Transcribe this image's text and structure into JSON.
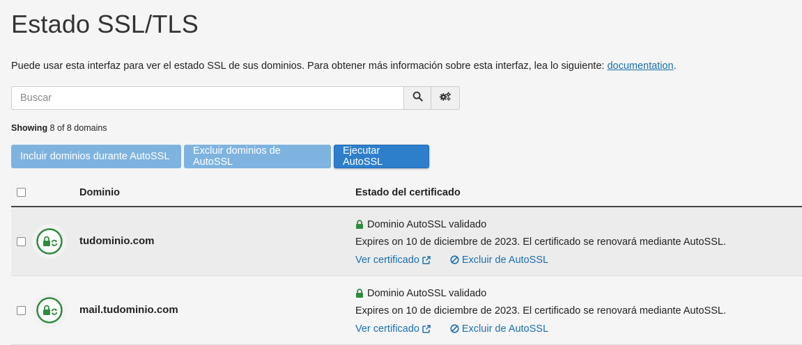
{
  "page": {
    "title": "Estado SSL/TLS",
    "intro_text": "Puede usar esta interfaz para ver el estado SSL de sus dominios. Para obtener más información sobre esta interfaz, lea lo siguiente: ",
    "intro_link": "documentation",
    "intro_end": "."
  },
  "search": {
    "placeholder": "Buscar"
  },
  "showing": {
    "label": "Showing",
    "text": "8 of 8 domains"
  },
  "actions": {
    "include": "Incluir dominios durante AutoSSL",
    "exclude": "Excluir dominios de AutoSSL",
    "run": "Ejecutar AutoSSL"
  },
  "table": {
    "col_domain": "Dominio",
    "col_status": "Estado del certificado",
    "rows": [
      {
        "domain": "tudominio.com",
        "status": "Dominio AutoSSL validado",
        "expires": "Expires on 10 de diciembre de 2023. El certificado se renovará mediante AutoSSL.",
        "view": "Ver certificado",
        "exclude": "Excluir de AutoSSL"
      },
      {
        "domain": "mail.tudominio.com",
        "status": "Dominio AutoSSL validado",
        "expires": "Expires on 10 de diciembre de 2023. El certificado se renovará mediante AutoSSL.",
        "view": "Ver certificado",
        "exclude": "Excluir de AutoSSL"
      }
    ]
  },
  "colors": {
    "link": "#1a6fb0",
    "valid_green": "#2e8b3e",
    "primary": "#2e7fcb",
    "light_button": "#7fb3df"
  },
  "icons": [
    "search-icon",
    "gears-icon",
    "lock-icon",
    "external-link-icon",
    "ban-icon",
    "ssl-status-icon"
  ]
}
